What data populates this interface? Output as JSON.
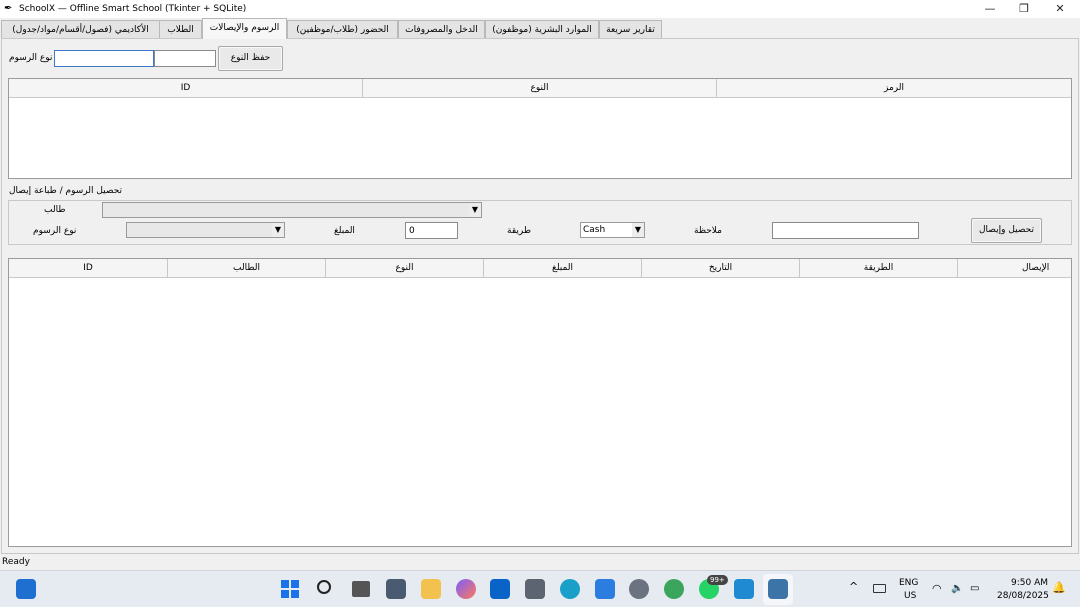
{
  "window": {
    "title": "SchoolX — Offline Smart School (Tkinter + SQLite)",
    "minimize": "—",
    "maximize": "❐",
    "close": "✕"
  },
  "tabs": [
    "الأكاديمي (فصول/أقسام/مواد/جدول)",
    "الطلاب",
    "الرسوم والإيصالات",
    "الحضور (طلاب/موظفين)",
    "الدخل والمصروفات",
    "الموارد البشرية (موظفون)",
    "تقارير سريعة"
  ],
  "fee_type": {
    "label": "نوع الرسوم",
    "save_button": "حفظ النوع",
    "name_value": "",
    "code_value": ""
  },
  "types_table": {
    "columns": [
      "ID",
      "النوع",
      "الرمز"
    ]
  },
  "collect": {
    "section_title": "تحصيل الرسوم / طباعة إيصال",
    "student_label": "طالب",
    "student_value": "",
    "fee_type_label": "نوع الرسوم",
    "fee_type_value": "",
    "amount_label": "المبلغ",
    "amount_value": "0",
    "method_label": "طريقة",
    "method_value": "Cash",
    "note_label": "ملاحظة",
    "note_value": "",
    "collect_button": "تحصيل وإيصال"
  },
  "receipts_table": {
    "columns": [
      "ID",
      "الطالب",
      "النوع",
      "المبلغ",
      "التاريخ",
      "الطريقة",
      "الإيصال"
    ]
  },
  "status": {
    "text": "Ready"
  },
  "taskbar": {
    "language": "ENG",
    "region": "US",
    "time": "9:50 AM",
    "date": "28/08/2025",
    "badge": "99+",
    "chevron": "^",
    "icons": [
      "widgets-icon",
      "start-icon",
      "search-icon",
      "task-view-icon",
      "camera-icon",
      "file-explorer-icon",
      "copilot-icon",
      "outlook-icon",
      "calculator-icon",
      "edge-icon",
      "store-icon",
      "settings-icon",
      "chrome-icon",
      "whatsapp-icon",
      "vscode-icon",
      "python-icon"
    ]
  }
}
